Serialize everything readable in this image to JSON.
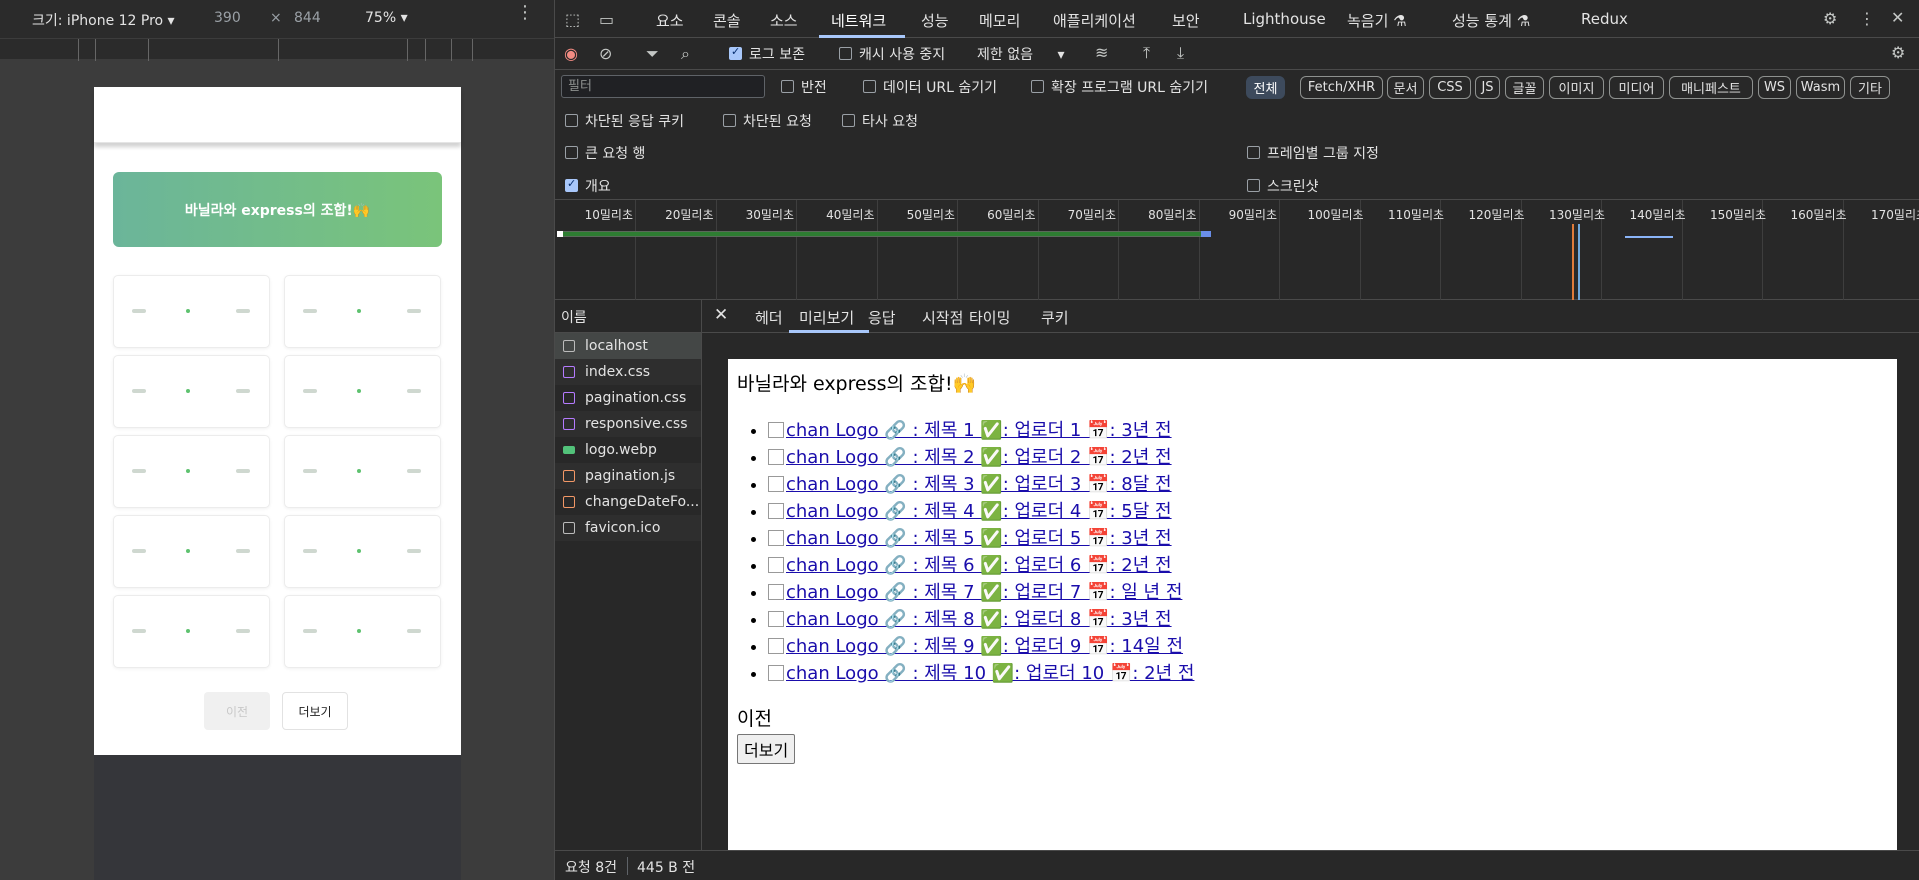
{
  "device_toolbar": {
    "size_label": "크기: iPhone 12 Pro",
    "width": "390",
    "times": "×",
    "height": "844",
    "zoom": "75%"
  },
  "mobile_page": {
    "banner_text": "바닐라와 express의 조합!🙌",
    "card_count": 10,
    "prev_label": "이전",
    "more_label": "더보기"
  },
  "devtools_tabs": [
    "요소",
    "콘솔",
    "소스",
    "네트워크",
    "성능",
    "메모리",
    "애플리케이션",
    "보안",
    "Lighthouse",
    "녹음기 ⚗",
    "성능 통계 ⚗",
    "Redux"
  ],
  "active_tab": "네트워크",
  "net_toolbar": {
    "preserve_log": "로그 보존",
    "disable_cache": "캐시 사용 중지",
    "throttle": "제한 없음"
  },
  "filter_row": {
    "placeholder": "필터",
    "invert": "반전",
    "hide_data_url": "데이터 URL 숨기기",
    "hide_ext_url": "확장 프로그램 URL 숨기기",
    "chips": [
      "전체",
      "Fetch/XHR",
      "문서",
      "CSS",
      "JS",
      "글꼴",
      "이미지",
      "미디어",
      "매니페스트",
      "WS",
      "Wasm",
      "기타"
    ]
  },
  "options": {
    "blocked_cookies": "차단된 응답 쿠키",
    "blocked_requests": "차단된 요청",
    "third_party": "타사 요청",
    "big_rows": "큰 요청 행",
    "group_by_frame": "프레임별 그룹 지정",
    "overview": "개요",
    "screenshots": "스크린샷"
  },
  "timeline_ticks": [
    "10밀리초",
    "20밀리초",
    "30밀리초",
    "40밀리초",
    "50밀리초",
    "60밀리초",
    "70밀리초",
    "80밀리초",
    "90밀리초",
    "100밀리초",
    "110밀리초",
    "120밀리초",
    "130밀리초",
    "140밀리초",
    "150밀리초",
    "160밀리초",
    "170밀리초"
  ],
  "name_header": "이름",
  "requests": [
    {
      "name": "localhost",
      "type": "doc"
    },
    {
      "name": "index.css",
      "type": "css"
    },
    {
      "name": "pagination.css",
      "type": "css"
    },
    {
      "name": "responsive.css",
      "type": "css"
    },
    {
      "name": "logo.webp",
      "type": "img"
    },
    {
      "name": "pagination.js",
      "type": "js"
    },
    {
      "name": "changeDateFo...",
      "type": "js"
    },
    {
      "name": "favicon.ico",
      "type": "doc"
    }
  ],
  "status_bar": {
    "requests": "요청 8건",
    "transferred": "445 B 전"
  },
  "detail_tabs": [
    "헤더",
    "미리보기",
    "응답",
    "시작점",
    "타이밍",
    "쿠키"
  ],
  "active_detail_tab": "미리보기",
  "preview": {
    "title": "바닐라와 express의 조합!🙌",
    "items": [
      "chan Logo 🔗 : 제목 1 ✅: 업로더 1 📅: 3년 전",
      "chan Logo 🔗 : 제목 2 ✅: 업로더 2 📅: 2년 전",
      "chan Logo 🔗 : 제목 3 ✅: 업로더 3 📅: 8달 전",
      "chan Logo 🔗 : 제목 4 ✅: 업로더 4 📅: 5달 전",
      "chan Logo 🔗 : 제목 5 ✅: 업로더 5 📅: 3년 전",
      "chan Logo 🔗 : 제목 6 ✅: 업로더 6 📅: 2년 전",
      "chan Logo 🔗 : 제목 7 ✅: 업로더 7 📅: 일 년 전",
      "chan Logo 🔗 : 제목 8 ✅: 업로더 8 📅: 3년 전",
      "chan Logo 🔗 : 제목 9 ✅: 업로더 9 📅: 14일 전",
      "chan Logo 🔗 : 제목 10 ✅: 업로더 10 📅: 2년 전"
    ],
    "prev_label": "이전",
    "more_label": "더보기"
  },
  "colors": {
    "accent": "#a8c7fa",
    "record_red": "#f28b82",
    "banner_start": "#6bb59a",
    "banner_end": "#7ac47a"
  }
}
